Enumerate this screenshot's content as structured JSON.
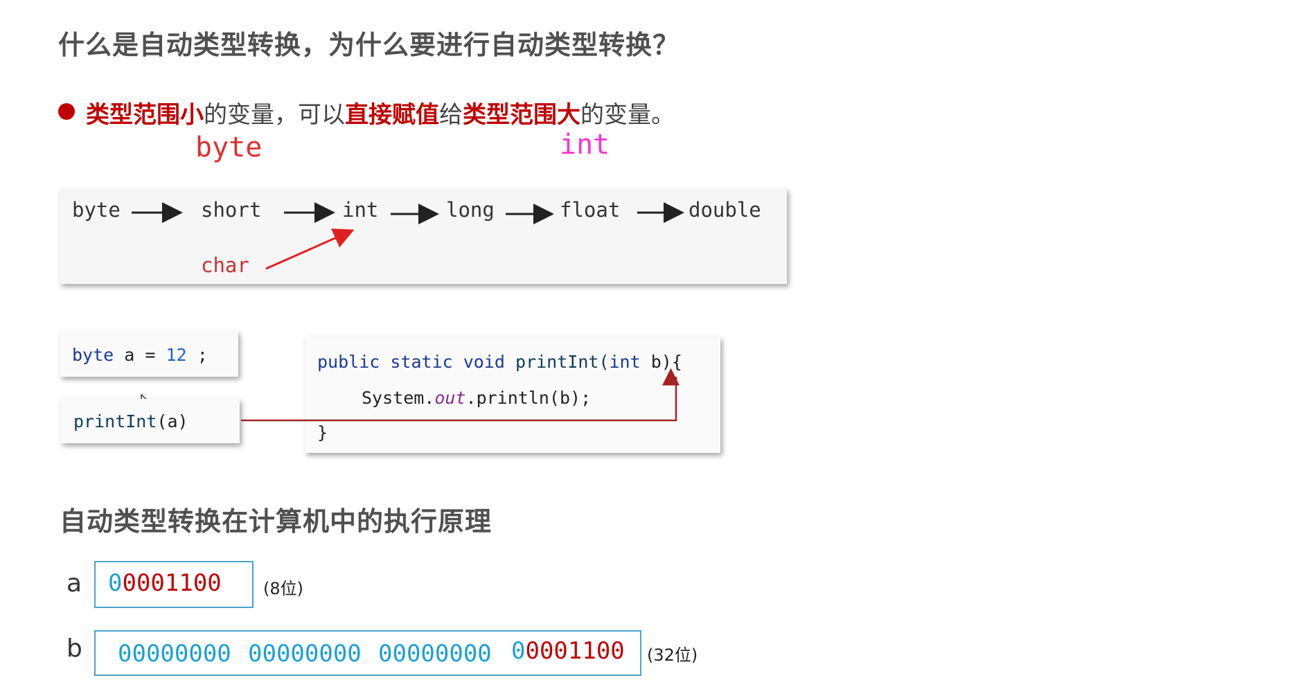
{
  "title": "什么是自动类型转换，为什么要进行自动类型转换？",
  "bullet": {
    "part1": "类型范围小",
    "part2": "的变量，可以",
    "part3": "直接赋值",
    "part4": "给",
    "part5": "类型范围大",
    "part6": "的变量。"
  },
  "annotations": {
    "left": "byte",
    "right": "int",
    "left_color": "#e03030",
    "right_color": "#ff33cc"
  },
  "flow": {
    "items": [
      "byte",
      "short",
      "int",
      "long",
      "float",
      "double"
    ],
    "side": "char"
  },
  "code": {
    "decl_type": "byte",
    "decl_var": "a",
    "decl_eq": "=",
    "decl_value": "12",
    "decl_semi": ";",
    "call_fn": "printInt",
    "call_args": "(a)",
    "m_public": "public",
    "m_static": "static",
    "m_void": "void",
    "m_name": "printInt(",
    "m_type": "int",
    "m_rest": "b){",
    "body_pre": "System.",
    "body_out": "out",
    "body_post": ".println(b);",
    "close": "}"
  },
  "section2": {
    "title": "自动类型转换在计算机中的执行原理",
    "a_label": "a",
    "a_value": "00001100",
    "a_bits": "(8位)",
    "b_label": "b",
    "b_zero1": "00000000",
    "b_zero2": "00000000",
    "b_zero3": "00000000",
    "b_value": "00001100",
    "b_bits": "(32位)"
  },
  "colors": {
    "accent_red": "#c00000",
    "binary_blue": "#1a9fd6",
    "box_border": "#4ba3c8"
  }
}
